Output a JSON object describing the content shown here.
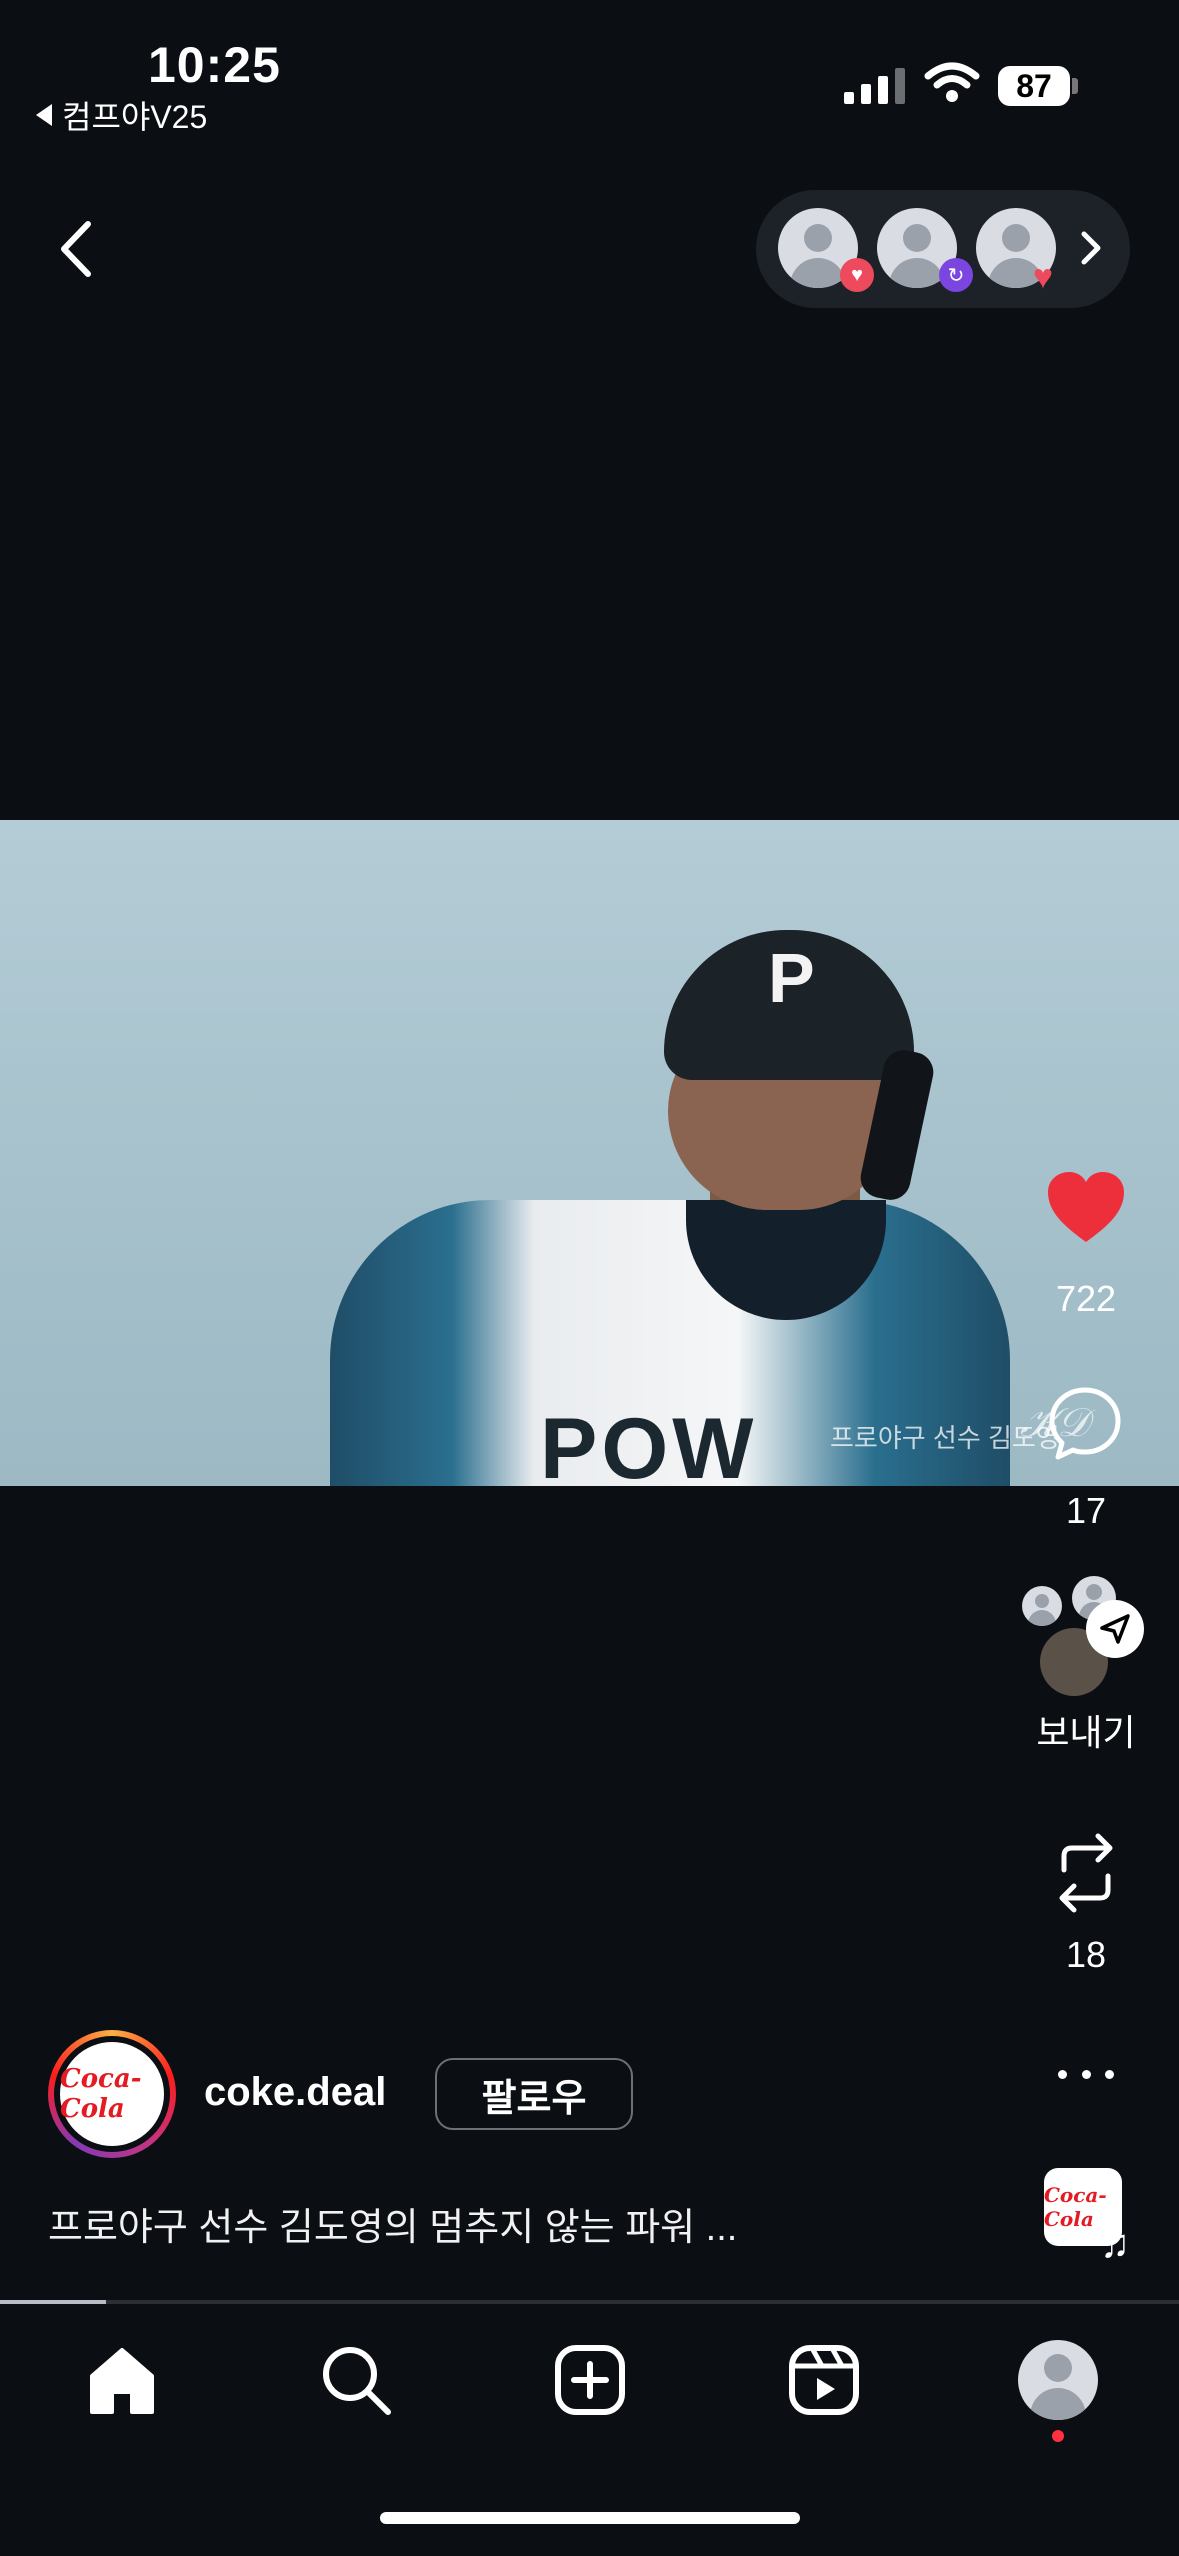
{
  "status_bar": {
    "time": "10:25",
    "back_app_label": "컴프야V25",
    "battery_level": "87"
  },
  "top_nav": {
    "back_icon": "chevron-left-icon",
    "viewer_badges": [
      "heart",
      "repost",
      "heart"
    ],
    "chevron_icon": "chevron-right-icon"
  },
  "video": {
    "helmet_letter": "P",
    "jersey_text": "POW",
    "watermark_text": "프로야구 선수 김도영",
    "progress_fraction": 0.09
  },
  "actions": {
    "like_count": "722",
    "comment_count": "17",
    "send_label": "보내기",
    "repost_count": "18",
    "more_icon": "more-icon"
  },
  "post": {
    "username": "coke.deal",
    "follow_label": "팔로우",
    "caption": "프로야구 선수 김도영의 멈추지 않는 파워 ...",
    "brand_logo_text": "Coca-Cola"
  },
  "bottom_nav": {
    "tabs": [
      "home-icon",
      "search-icon",
      "create-icon",
      "reels-icon",
      "profile-icon"
    ]
  },
  "colors": {
    "background": "#0b0e13",
    "like_red": "#ed2f3c",
    "notification_red": "#ff3040",
    "repost_purple": "#7b45e0"
  }
}
